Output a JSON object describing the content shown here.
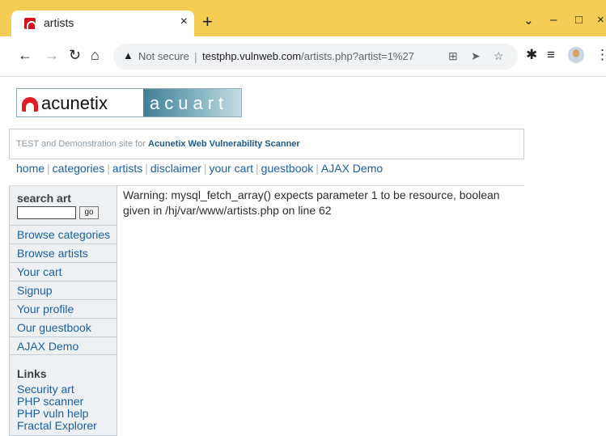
{
  "browser": {
    "tab_title": "artists",
    "tab_close": "×",
    "new_tab": "+",
    "controls": {
      "dropdown": "⌄",
      "minimize": "–",
      "maximize": "□",
      "close": "×"
    },
    "security_label": "Not secure",
    "url_host": "testphp.vulnweb.com",
    "url_path": "/artists.php?artist=1%27",
    "icons": [
      "back-icon",
      "forward-icon",
      "reload-icon",
      "home-icon",
      "warning-icon",
      "translate-icon",
      "send-icon",
      "star-icon",
      "extensions-icon",
      "reading-list-icon",
      "avatar",
      "menu-icon"
    ]
  },
  "site": {
    "logo_left": "acunetix",
    "logo_right": "acuart",
    "tagline_prefix": "TEST and Demonstration site for ",
    "tagline_link": "Acunetix Web Vulnerability Scanner",
    "nav": [
      "home",
      "categories",
      "artists",
      "disclaimer",
      "your cart",
      "guestbook",
      "AJAX Demo"
    ],
    "search_label": "search art",
    "search_value": "",
    "search_button": "go",
    "sidebar": [
      "Browse categories",
      "Browse artists",
      "Your cart",
      "Signup",
      "Your profile",
      "Our guestbook",
      "AJAX Demo"
    ],
    "links_heading": "Links",
    "links": [
      "Security art",
      "PHP scanner",
      "PHP vuln help",
      "Fractal Explorer"
    ],
    "warning": "Warning: mysql_fetch_array() expects parameter 1 to be resource, boolean given in /hj/var/www/artists.php on line 62"
  },
  "colors": {
    "tabbar": "#f5cd55",
    "link": "#1a5fa0",
    "sidebar_bg": "#eef1f4"
  }
}
